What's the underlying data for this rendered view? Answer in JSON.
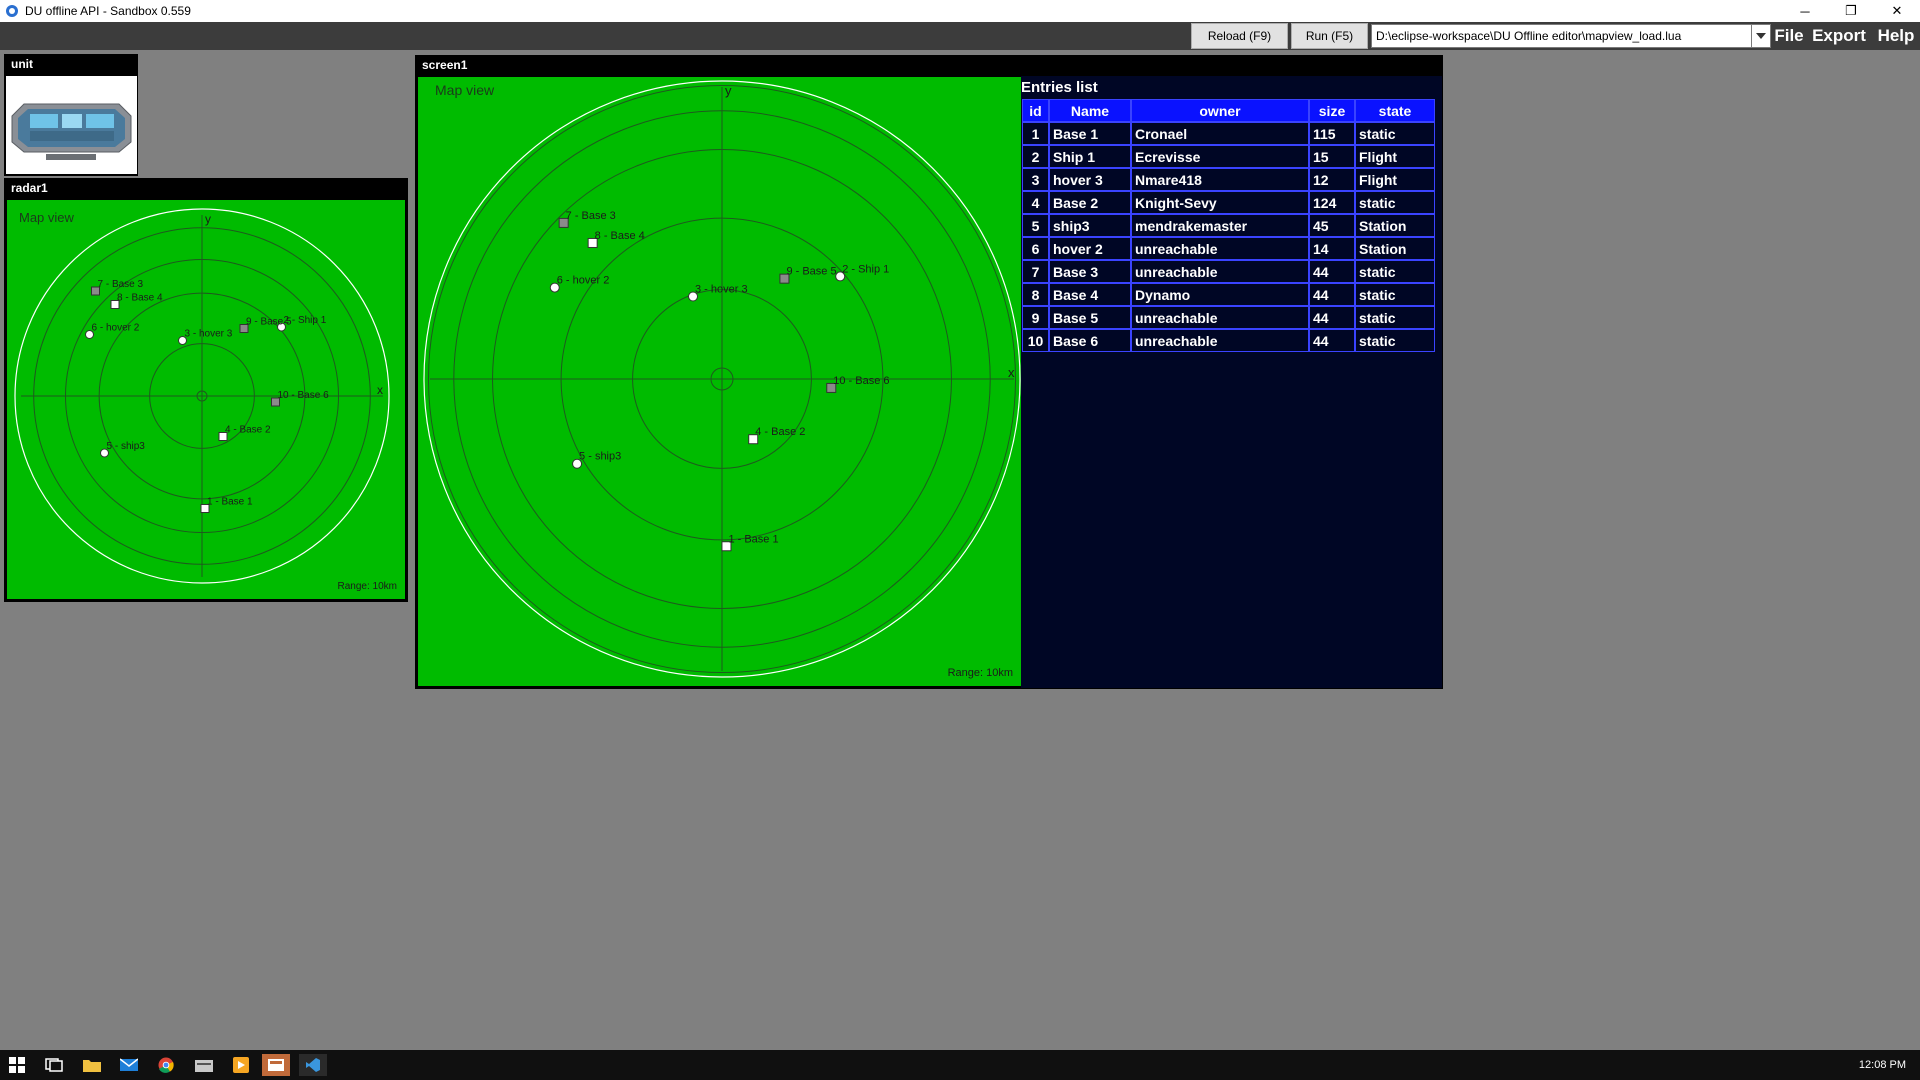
{
  "window": {
    "title": "DU offline API - Sandbox 0.559",
    "minimize_glyph": "─",
    "restore_glyph": "❐",
    "close_glyph": "✕"
  },
  "toolbar": {
    "reload_label": "Reload (F9)",
    "run_label": "Run (F5)",
    "path_value": "D:\\eclipse-workspace\\DU Offline editor\\mapview_load.lua",
    "menu_file": "File",
    "menu_export": "Export",
    "menu_help": "Help"
  },
  "panels": {
    "unit_title": "unit",
    "radar_title": "radar1",
    "screen_title": "screen1"
  },
  "map": {
    "title": "Map view",
    "range_label": "Range: 10km",
    "axis_x": "x",
    "axis_y": "y",
    "markers": [
      {
        "label": "1 - Base 1",
        "shape": "square",
        "x": 0.2,
        "y": -7.5
      },
      {
        "label": "2 - Ship 1",
        "shape": "circle",
        "x": 5.3,
        "y": 4.6
      },
      {
        "label": "3 - hover 3",
        "shape": "circle",
        "x": -1.3,
        "y": 3.7
      },
      {
        "label": "4 - Base 2",
        "shape": "square",
        "x": 1.4,
        "y": -2.7
      },
      {
        "label": "5 - ship3",
        "shape": "circle",
        "x": -6.5,
        "y": -3.8
      },
      {
        "label": "6 - hover 2",
        "shape": "circle",
        "x": -7.5,
        "y": 4.1
      },
      {
        "label": "7 - Base 3",
        "shape": "square-gray",
        "x": -7.1,
        "y": 7.0
      },
      {
        "label": "8 - Base 4",
        "shape": "square",
        "x": -5.8,
        "y": 6.1
      },
      {
        "label": "9 - Base 5",
        "shape": "square-gray",
        "x": 2.8,
        "y": 4.5
      },
      {
        "label": "10 - Base 6",
        "shape": "square-gray",
        "x": 4.9,
        "y": -0.4
      }
    ]
  },
  "entries": {
    "title": "Entries list",
    "columns": [
      "id",
      "Name",
      "owner",
      "size",
      "state"
    ],
    "rows": [
      [
        "1",
        "Base 1",
        "Cronael",
        "115",
        "static"
      ],
      [
        "2",
        "Ship 1",
        "Ecrevisse",
        "15",
        "Flight"
      ],
      [
        "3",
        "hover 3",
        "Nmare418",
        "12",
        "Flight"
      ],
      [
        "4",
        "Base 2",
        "Knight-Sevy",
        "124",
        "static"
      ],
      [
        "5",
        "ship3",
        "mendrakemaster",
        "45",
        "Station"
      ],
      [
        "6",
        "hover 2",
        "unreachable",
        "14",
        "Station"
      ],
      [
        "7",
        "Base 3",
        "unreachable",
        "44",
        "static"
      ],
      [
        "8",
        "Base 4",
        "Dynamo",
        "44",
        "static"
      ],
      [
        "9",
        "Base 5",
        "unreachable",
        "44",
        "static"
      ],
      [
        "10",
        "Base 6",
        "unreachable",
        "44",
        "static"
      ]
    ]
  },
  "taskbar": {
    "clock": "12:08 PM",
    "icons": [
      "windows-start-icon",
      "task-view-icon",
      "file-explorer-icon",
      "mail-icon",
      "chrome-icon",
      "folder-icon",
      "media-player-icon",
      "app-icon",
      "vscode-icon"
    ]
  },
  "colors": {
    "radar_green": "#00bb00",
    "table_header": "#0a12ff",
    "table_border": "#3a43ff",
    "table_bg": "#000625"
  }
}
